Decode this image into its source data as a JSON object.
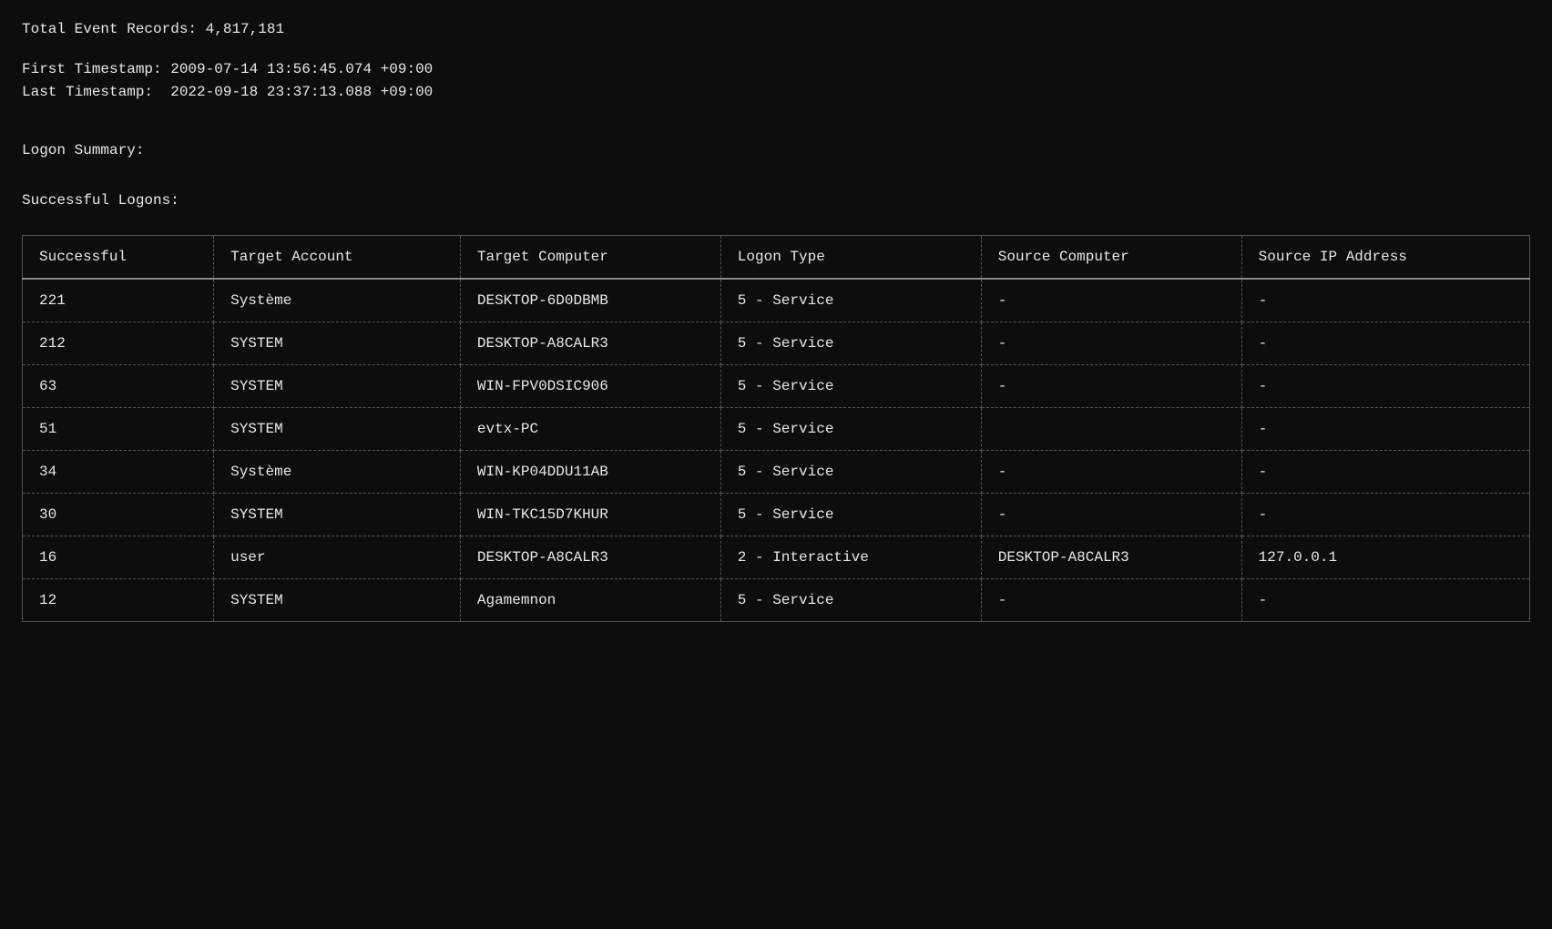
{
  "summary": {
    "total_records_label": "Total Event Records: 4,817,181",
    "first_timestamp_label": "First Timestamp: 2009-07-14 13:56:45.074 +09:00",
    "last_timestamp_label": "Last Timestamp:  2022-09-18 23:37:13.088 +09:00",
    "logon_summary_label": "Logon Summary:",
    "successful_logons_label": "Successful Logons:"
  },
  "table": {
    "headers": [
      "Successful",
      "Target Account",
      "Target Computer",
      "Logon Type",
      "Source Computer",
      "Source IP Address"
    ],
    "rows": [
      [
        "221",
        "Système",
        "DESKTOP-6D0DBMB",
        "5 - Service",
        "-",
        "-"
      ],
      [
        "212",
        "SYSTEM",
        "DESKTOP-A8CALR3",
        "5 - Service",
        "-",
        "-"
      ],
      [
        "63",
        "SYSTEM",
        "WIN-FPV0DSIC906",
        "5 - Service",
        "-",
        "-"
      ],
      [
        "51",
        "SYSTEM",
        "evtx-PC",
        "5 - Service",
        "",
        "-"
      ],
      [
        "34",
        "Système",
        "WIN-KP04DDU11AB",
        "5 - Service",
        "-",
        "-"
      ],
      [
        "30",
        "SYSTEM",
        "WIN-TKC15D7KHUR",
        "5 - Service",
        "-",
        "-"
      ],
      [
        "16",
        "user",
        "DESKTOP-A8CALR3",
        "2 - Interactive",
        "DESKTOP-A8CALR3",
        "127.0.0.1"
      ],
      [
        "12",
        "SYSTEM",
        "Agamemnon",
        "5 - Service",
        "-",
        "-"
      ]
    ]
  }
}
